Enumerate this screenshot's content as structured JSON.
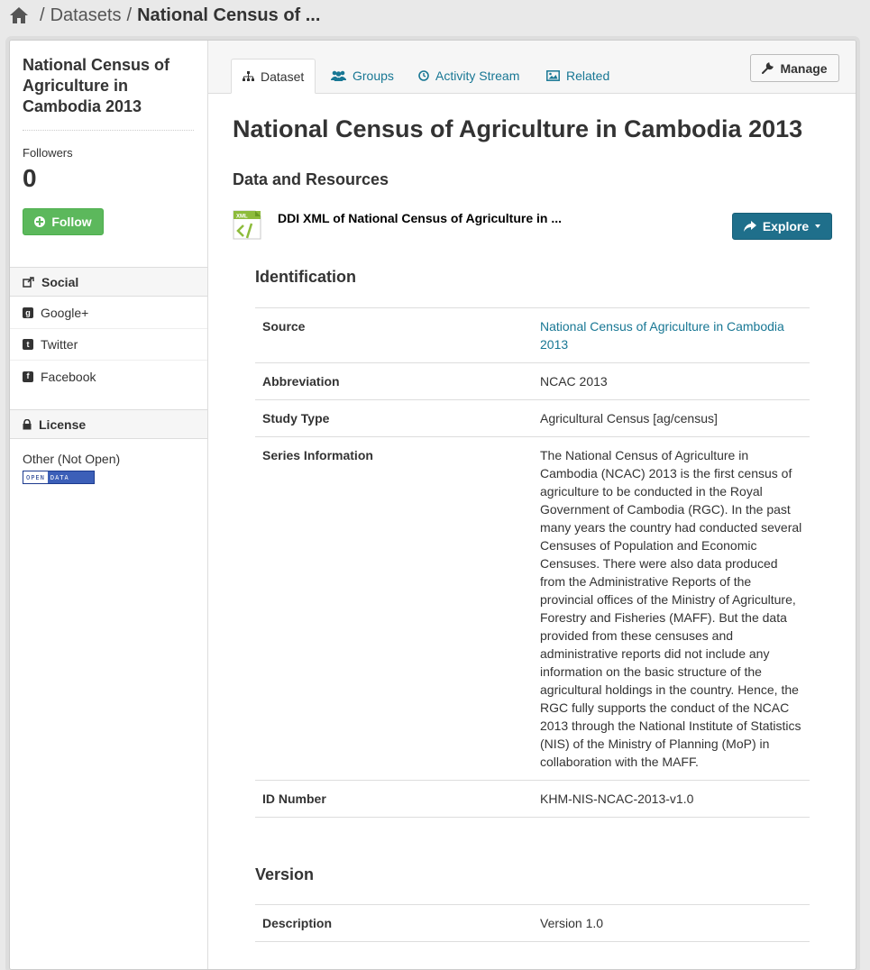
{
  "breadcrumb": {
    "home_icon": "home-icon",
    "separator": "/",
    "datasets": "Datasets",
    "current": "National Census of ..."
  },
  "sidebar": {
    "title": "National Census of Agriculture in Cambodia 2013",
    "followers_label": "Followers",
    "followers_count": "0",
    "follow_label": "Follow",
    "social_heading": "Social",
    "social_items": [
      {
        "label": "Google+",
        "icon": "google-plus-icon"
      },
      {
        "label": "Twitter",
        "icon": "twitter-icon"
      },
      {
        "label": "Facebook",
        "icon": "facebook-icon"
      }
    ],
    "license_heading": "License",
    "license_text": "Other (Not Open)",
    "open_data_badge": [
      "OPEN",
      "DATA"
    ]
  },
  "tabs": [
    {
      "label": "Dataset",
      "icon": "sitemap-icon",
      "active": true
    },
    {
      "label": "Groups",
      "icon": "users-icon",
      "active": false
    },
    {
      "label": "Activity Stream",
      "icon": "clock-icon",
      "active": false
    },
    {
      "label": "Related",
      "icon": "picture-icon",
      "active": false
    }
  ],
  "manage_label": "Manage",
  "main": {
    "title": "National Census of Agriculture in Cambodia 2013",
    "data_resources_heading": "Data and Resources",
    "resource": {
      "format": "XML",
      "title": "DDI XML of National Census of Agriculture in ...",
      "explore_label": "Explore"
    }
  },
  "identification": {
    "heading": "Identification",
    "rows": [
      {
        "key": "Source",
        "value": "National Census of Agriculture in Cambodia 2013",
        "link": true
      },
      {
        "key": "Abbreviation",
        "value": "NCAC 2013"
      },
      {
        "key": "Study Type",
        "value": "Agricultural Census [ag/census]"
      },
      {
        "key": "Series Information",
        "value": "The National Census of Agriculture in Cambodia (NCAC) 2013 is the first census of agriculture to be conducted in the Royal Government of Cambodia (RGC). In the past many years the country had conducted several Censuses of Population and Economic Censuses. There were also data produced from the Administrative Reports of the provincial offices of the Ministry of Agriculture, Forestry and Fisheries (MAFF). But the data provided from these censuses and administrative reports did not include any information on the basic structure of the agricultural holdings in the country. Hence, the RGC fully supports the conduct of the NCAC 2013 through the National Institute of Statistics (NIS) of the Ministry of Planning (MoP) in collaboration with the MAFF."
      },
      {
        "key": "ID Number",
        "value": "KHM-NIS-NCAC-2013-v1.0"
      }
    ]
  },
  "version": {
    "heading": "Version",
    "rows": [
      {
        "key": "Description",
        "value": "Version 1.0"
      }
    ]
  }
}
